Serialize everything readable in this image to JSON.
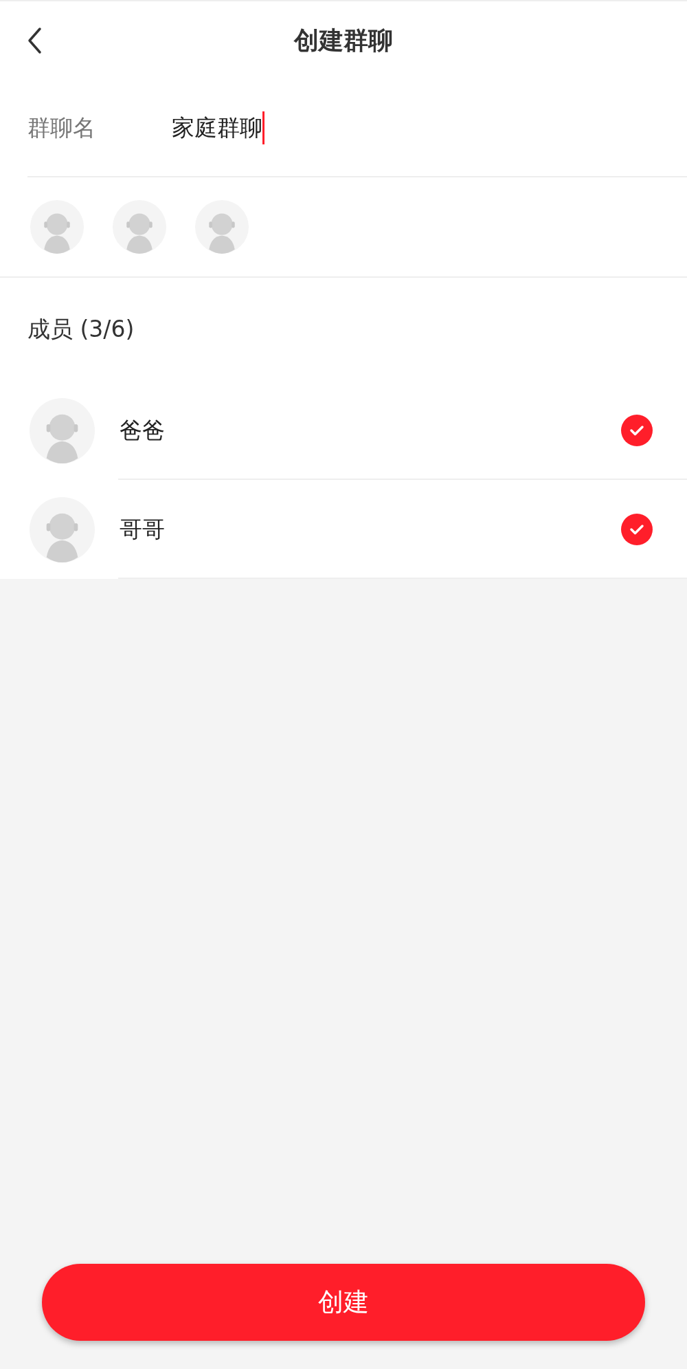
{
  "header": {
    "title": "创建群聊"
  },
  "group_name": {
    "label": "群聊名",
    "value": "家庭群聊",
    "focused": true
  },
  "selected_avatars": [
    {
      "kind": "avatar"
    },
    {
      "kind": "avatar"
    },
    {
      "kind": "avatar"
    }
  ],
  "members_heading": "成员 (3/6)",
  "members": [
    {
      "name": "爸爸",
      "selected": true
    },
    {
      "name": "哥哥",
      "selected": true
    }
  ],
  "create_button": "创建"
}
